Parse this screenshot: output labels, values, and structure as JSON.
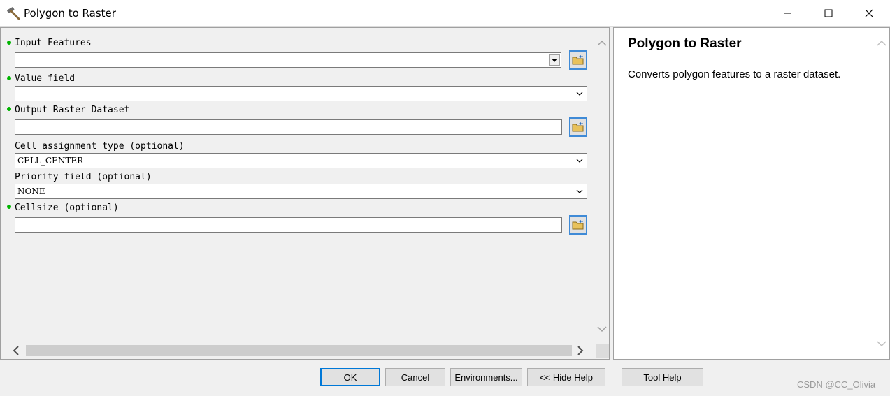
{
  "window": {
    "title": "Polygon to Raster",
    "icon": "hammer-icon",
    "controls": [
      "minimize-icon",
      "maximize-icon",
      "close-icon"
    ]
  },
  "params": {
    "input_features": {
      "label": "Input Features",
      "value": "",
      "required": true
    },
    "value_field": {
      "label": "Value field",
      "value": "",
      "required": true
    },
    "output_raster": {
      "label": "Output Raster Dataset",
      "value": "",
      "required": true
    },
    "cell_assignment": {
      "label": "Cell assignment type (optional)",
      "value": "CELL_CENTER",
      "required": false
    },
    "priority_field": {
      "label": "Priority field (optional)",
      "value": "NONE",
      "required": false
    },
    "cellsize": {
      "label": "Cellsize (optional)",
      "value": "",
      "required": true
    }
  },
  "help": {
    "title": "Polygon to Raster",
    "description": "Converts polygon features to a raster dataset."
  },
  "buttons": {
    "ok": "OK",
    "cancel": "Cancel",
    "environments": "Environments...",
    "hide_help": "<< Hide Help",
    "tool_help": "Tool Help"
  },
  "watermark": "CSDN @CC_Olivia",
  "colors": {
    "required_dot": "#00b400",
    "browse_border": "#3f8ad6",
    "default_button_border": "#0078d7"
  }
}
